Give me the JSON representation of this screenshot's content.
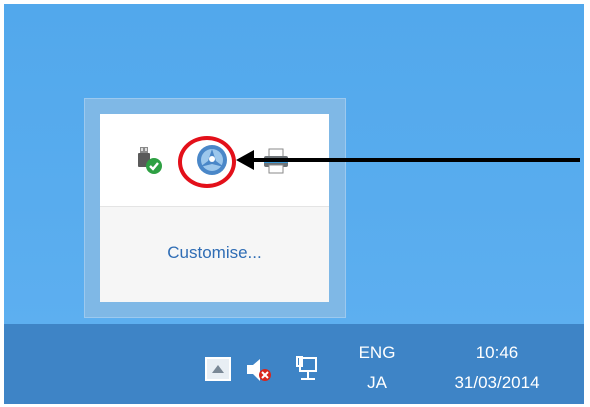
{
  "flyout": {
    "icons": [
      "usb-safely-remove-icon",
      "app-tray-icon",
      "printer-icon"
    ],
    "customise_label": "Customise..."
  },
  "annotation": {
    "circle_color": "#e3101a",
    "arrow_color": "#000000"
  },
  "taskbar": {
    "show_hidden_icon": "chevron-up-icon",
    "tray_icons": [
      "speaker-muted-icon",
      "network-icon"
    ],
    "language": {
      "primary": "ENG",
      "secondary": "JA"
    },
    "clock": {
      "time": "10:46",
      "date": "31/03/2014"
    }
  },
  "colors": {
    "desktop": "#58acee",
    "taskbar": "#3e84c6",
    "link": "#2f6db5"
  }
}
